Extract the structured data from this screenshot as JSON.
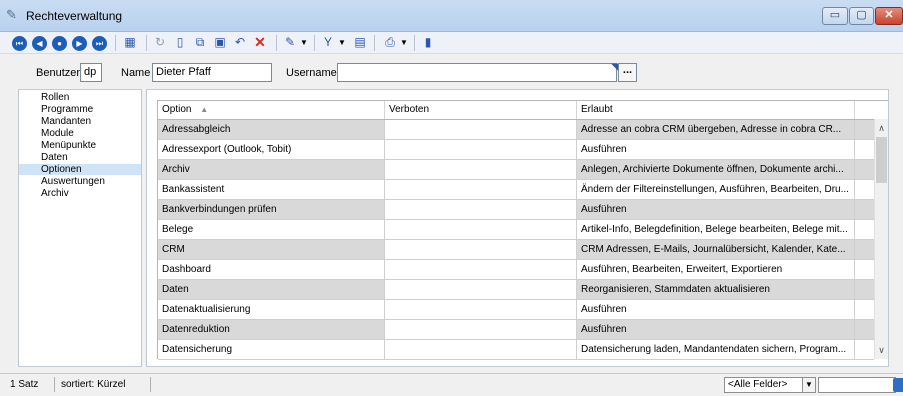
{
  "window": {
    "title": "Rechteverwaltung"
  },
  "toolbar": {
    "nav_first": "⏮",
    "nav_prev": "◀",
    "nav_stop": "●",
    "nav_next": "▶",
    "nav_last": "⏭",
    "icons": [
      "calendar-icon",
      "refresh-icon",
      "new-icon",
      "copy-icon",
      "save-icon",
      "undo-icon",
      "delete-icon",
      "edit-icon",
      "filter-icon",
      "document-icon",
      "print-icon",
      "book-icon"
    ],
    "colors": {
      "nav": "#1d5db7",
      "delete": "#d62a1e"
    }
  },
  "filter": {
    "benutzer_label": "Benutzer",
    "benutzer_value": "dp",
    "name_label": "Name",
    "name_value": "Dieter Pfaff",
    "username_label": "Username",
    "username_value": "",
    "lookup_button": "..."
  },
  "sidebar": {
    "items": [
      "Rollen",
      "Programme",
      "Mandanten",
      "Module",
      "Menüpunkte",
      "Daten",
      "Optionen",
      "Auswertungen",
      "Archiv"
    ],
    "selected": "Optionen"
  },
  "grid": {
    "columns": [
      "Option",
      "Verboten",
      "Erlaubt"
    ],
    "sort_indicator": "▲",
    "rows": [
      {
        "option": "Adressabgleich",
        "verboten": "",
        "erlaubt": "Adresse an cobra CRM übergeben, Adresse in cobra CR..."
      },
      {
        "option": "Adressexport (Outlook, Tobit)",
        "verboten": "",
        "erlaubt": "Ausführen"
      },
      {
        "option": "Archiv",
        "verboten": "",
        "erlaubt": "Anlegen, Archivierte Dokumente öffnen, Dokumente archi..."
      },
      {
        "option": "Bankassistent",
        "verboten": "",
        "erlaubt": "Ändern der Filtereinstellungen, Ausführen, Bearbeiten, Dru..."
      },
      {
        "option": "Bankverbindungen prüfen",
        "verboten": "",
        "erlaubt": "Ausführen"
      },
      {
        "option": "Belege",
        "verboten": "",
        "erlaubt": "Artikel-Info, Belegdefinition, Belege bearbeiten, Belege mit..."
      },
      {
        "option": "CRM",
        "verboten": "",
        "erlaubt": "CRM Adressen, E-Mails, Journalübersicht, Kalender, Kate..."
      },
      {
        "option": "Dashboard",
        "verboten": "",
        "erlaubt": "Ausführen, Bearbeiten, Erweitert, Exportieren"
      },
      {
        "option": "Daten",
        "verboten": "",
        "erlaubt": "Reorganisieren, Stammdaten aktualisieren"
      },
      {
        "option": "Datenaktualisierung",
        "verboten": "",
        "erlaubt": "Ausführen"
      },
      {
        "option": "Datenreduktion",
        "verboten": "",
        "erlaubt": "Ausführen"
      },
      {
        "option": "Datensicherung",
        "verboten": "",
        "erlaubt": "Datensicherung laden, Mandantendaten sichern, Program..."
      }
    ]
  },
  "status": {
    "count": "1 Satz",
    "sort": "sortiert: Kürzel",
    "field_combo": "<Alle Felder>"
  }
}
